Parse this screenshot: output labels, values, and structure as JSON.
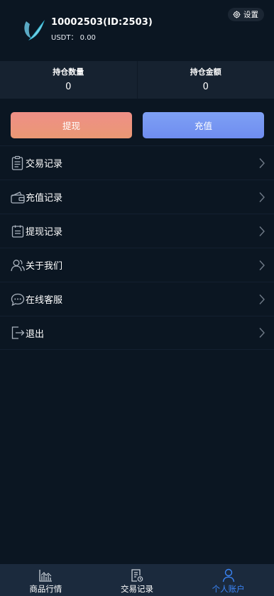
{
  "header": {
    "user_id": "10002503(ID:2503)",
    "balance": "USDT：  0.00",
    "settings_label": "设置"
  },
  "stats": {
    "position_count_label": "持仓数量",
    "position_count_value": "0",
    "position_amount_label": "持仓金额",
    "position_amount_value": "0"
  },
  "actions": {
    "withdraw_label": "提现",
    "recharge_label": "充值"
  },
  "menu": {
    "items": [
      {
        "label": "交易记录",
        "icon": "clipboard-icon"
      },
      {
        "label": "充值记录",
        "icon": "wallet-icon"
      },
      {
        "label": "提现记录",
        "icon": "calendar-icon"
      },
      {
        "label": "关于我们",
        "icon": "users-icon"
      },
      {
        "label": "在线客服",
        "icon": "chat-icon"
      },
      {
        "label": "退出",
        "icon": "logout-icon"
      }
    ]
  },
  "tabbar": {
    "items": [
      {
        "label": "商品行情",
        "icon": "chart-icon"
      },
      {
        "label": "交易记录",
        "icon": "document-icon"
      },
      {
        "label": "个人账户",
        "icon": "person-icon",
        "active": true
      }
    ]
  },
  "colors": {
    "background": "#0b1622",
    "stats_background": "#162230",
    "withdraw_gradient": [
      "#ef8f87",
      "#ea9874"
    ],
    "recharge_gradient": [
      "#7ea0f4",
      "#6f8df0"
    ],
    "tabbar_background": "#1b2a3d",
    "active_tab": "#3b85f6"
  }
}
